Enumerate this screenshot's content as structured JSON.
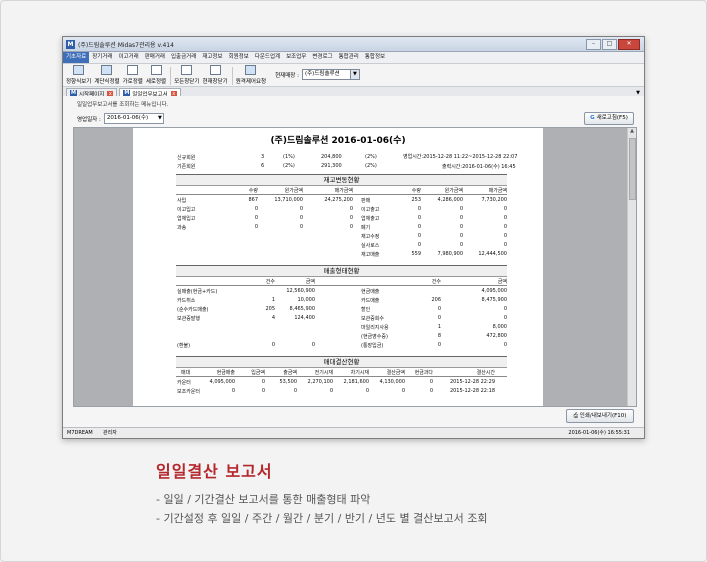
{
  "window": {
    "title": "(주)드림솔루션 Midas7관리용 v.414",
    "app_letter": "M",
    "btn_min": "–",
    "btn_max": "□",
    "btn_close": "✕"
  },
  "menu": [
    "기초자료",
    "장기거래",
    "이고거래",
    "판매거래",
    "입출금거래",
    "재고정보",
    "회원정보",
    "다운드업계",
    "보조업무",
    "변경로그",
    "통합관리",
    "통합정보"
  ],
  "toolbar": {
    "buttons": [
      "정향식보기",
      "계단식정렬",
      "가로정렬",
      "세로정렬",
      "모든창닫기",
      "현재창닫기",
      "원격제어요청"
    ],
    "store_label": "현재매장 :",
    "store_value": "(주)드림솔루션",
    "store_arrow": "▼"
  },
  "tabs": [
    {
      "label": "시작페이지",
      "icon": "M",
      "close": "x"
    },
    {
      "label": "일일업무보고서",
      "icon": "M",
      "close": "x"
    }
  ],
  "tab_dropdown": "▼",
  "content": {
    "hint": "일일업무보고서를 조회하는 메뉴입니다.",
    "date_label": "영업일자 :",
    "date_value": "2016-01-06(수)",
    "date_arrow": "▼",
    "refresh_icon": "G",
    "refresh_label": "새로고침(F5)",
    "print_label": "인쇄/내보내기(F10)",
    "print_icon": "⎙",
    "scroll_up": "▲"
  },
  "report": {
    "title": "(주)드림솔루션 2016-01-06(수)",
    "members": [
      {
        "label": "신규회원",
        "count": "3",
        "pct1": "(1%)",
        "amount": "204,800",
        "pct2": "(2%)"
      },
      {
        "label": "기존회원",
        "count": "6",
        "pct1": "(2%)",
        "amount": "291,300",
        "pct2": "(2%)"
      }
    ],
    "business_time": "영업시간:2015-12-28 11:22~2015-12-28 22:07",
    "print_time": "출력시간:2016-01-06(수) 16:45",
    "inventory": {
      "title": "재고변동현황",
      "headers": [
        "수량",
        "원가금액",
        "매가금액"
      ],
      "left": [
        [
          "사입",
          "867",
          "13,710,000",
          "24,275,200"
        ],
        [
          "이고입고",
          "0",
          "0",
          "0"
        ],
        [
          "업체입고",
          "0",
          "0",
          "0"
        ],
        [
          "과송",
          "0",
          "0",
          "0"
        ]
      ],
      "right": [
        [
          "판매",
          "253",
          "4,286,000",
          "7,730,200"
        ],
        [
          "이고출고",
          "0",
          "0",
          "0"
        ],
        [
          "업체출고",
          "0",
          "0",
          "0"
        ],
        [
          "폐기",
          "0",
          "0",
          "0"
        ],
        [
          "재고수정",
          "0",
          "0",
          "0"
        ],
        [
          "실사로스",
          "0",
          "0",
          "0"
        ],
        [
          "재고매출",
          "559",
          "7,980,900",
          "12,444,500"
        ]
      ]
    },
    "sales_type": {
      "title": "매출형태현황",
      "headers": [
        "건수",
        "금액"
      ],
      "right_header": [
        "건수",
        "금액"
      ],
      "left": [
        [
          "실매출(현금+카드)",
          "",
          "12,560,900"
        ],
        [
          "카드취소",
          "1",
          "10,000"
        ],
        [
          "(순수카드매출)",
          "205",
          "8,465,900"
        ],
        [
          "보관증발행",
          "4",
          "124,400"
        ],
        [
          "(환불)",
          "0",
          "0"
        ]
      ],
      "right": [
        [
          "현금매출",
          "",
          "4,095,000"
        ],
        [
          "카드매출",
          "206",
          "8,475,900"
        ],
        [
          "할인",
          "0",
          "0"
        ],
        [
          "보관증회수",
          "0",
          "0"
        ],
        [
          "마일리지사용",
          "1",
          "8,000"
        ],
        [
          "(현금영수증)",
          "8",
          "472,800"
        ],
        [
          "(통장입금)",
          "0",
          "0"
        ]
      ]
    },
    "closing": {
      "title": "매대결산현황",
      "headers": [
        "매대",
        "현금매출",
        "입금액",
        "출금액",
        "전기시재",
        "차기시재",
        "결산금액",
        "현금과다",
        "결산시간"
      ],
      "rows": [
        [
          "카운터",
          "4,095,000",
          "0",
          "53,500",
          "2,270,100",
          "2,181,600",
          "4,130,000",
          "0",
          "2015-12-28 22:29"
        ],
        [
          "보조카운터",
          "0",
          "0",
          "0",
          "0",
          "0",
          "0",
          "0",
          "2015-12-28 22:18"
        ]
      ]
    }
  },
  "status": {
    "left": "M7DREAM",
    "user": "관리자",
    "right": "2016-01-06(수) 16:55:31"
  },
  "caption": {
    "title": "일일결산 보고서",
    "line1": "- 일일 / 기간결산 보고서를 통한 매출형태 파악",
    "line2": "- 기간설정 후 일일 / 주간 / 월간 / 분기 / 반기 / 년도 별 결산보고서 조회"
  }
}
